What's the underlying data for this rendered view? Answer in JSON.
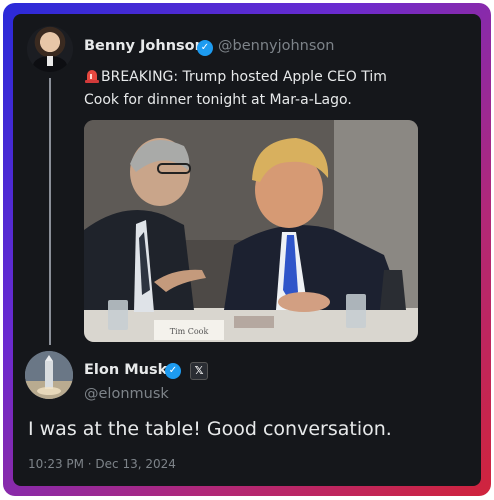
{
  "post": {
    "author_name": "Benny Johnson",
    "author_handle": "@bennyjohnson",
    "text": "BREAKING: Trump hosted Apple CEO Tim Cook for dinner tonight at Mar-a-Lago.",
    "siren_icon": "rotating-light-emoji",
    "image": {
      "place_card_text": "Tim Cook"
    }
  },
  "reply": {
    "author_name": "Elon Musk",
    "author_handle": "@elonmusk",
    "affiliate_badge": "𝕏",
    "text": "I was at the table! Good conversation.",
    "timestamp": "10:23 PM · Dec 13, 2024"
  },
  "colors": {
    "verified_blue": "#1d9bf0",
    "card_bg": "#15171b",
    "frame_gradient": [
      "#2a2ad8",
      "#6a2bd0",
      "#b0287a",
      "#d0243c"
    ]
  }
}
